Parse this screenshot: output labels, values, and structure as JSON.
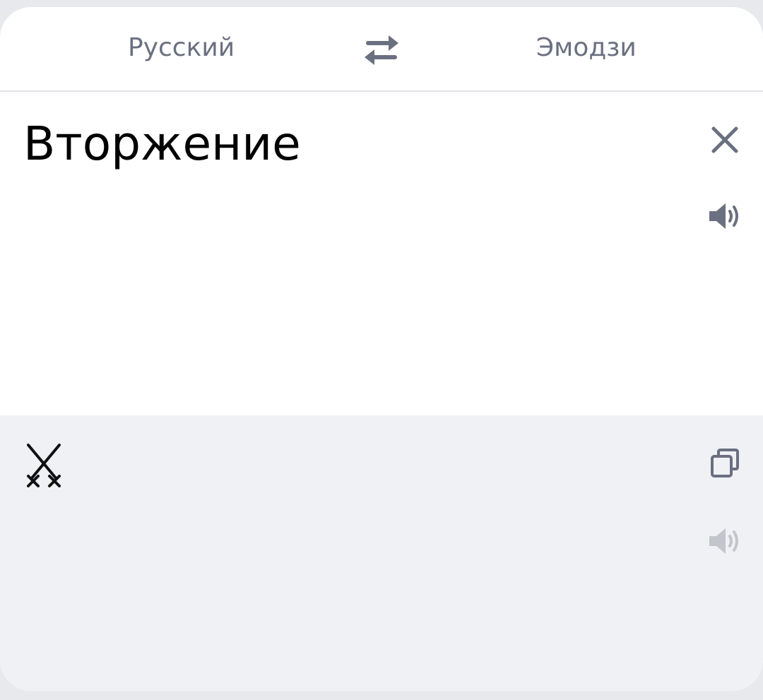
{
  "header": {
    "source_language": "Русский",
    "target_language": "Эмодзи",
    "swap_icon": "swap-arrows-icon"
  },
  "source": {
    "text": "Вторжение",
    "clear_icon": "close-icon",
    "speak_icon": "speaker-icon"
  },
  "result": {
    "emoji_icon": "crossed-swords-icon",
    "copy_icon": "copy-icon",
    "speak_icon": "speaker-icon"
  },
  "colors": {
    "icon": "#6a7080",
    "icon_disabled": "#c3c5cc",
    "result_bg": "#f0f1f5",
    "page_bg": "#e8e9ed"
  }
}
